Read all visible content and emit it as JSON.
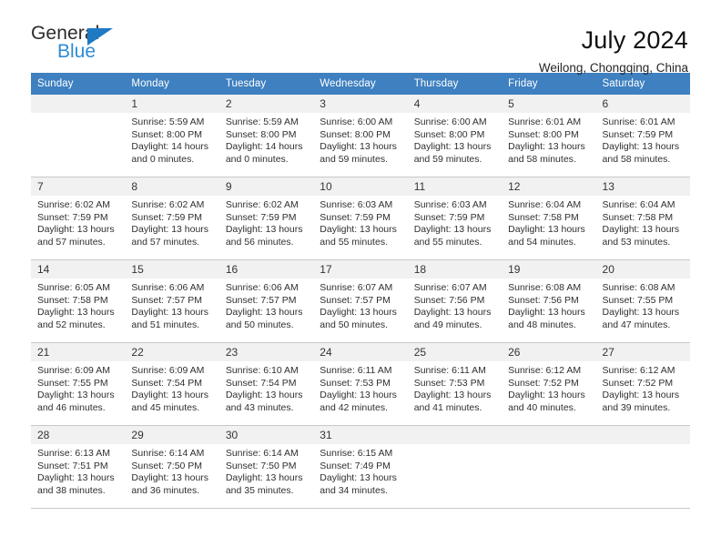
{
  "brand": {
    "name_top": "General",
    "name_bottom": "Blue",
    "accent_color": "#2e8bd4",
    "triangle_color": "#1f7ac4",
    "triangle_icon": "triangle-icon"
  },
  "header": {
    "title": "July 2024",
    "subtitle": "Weilong, Chongqing, China"
  },
  "calendar": {
    "header_bg": "#3e80c0",
    "header_text_color": "#ffffff",
    "daynum_bg": "#f1f1f1",
    "weekday_headers": [
      "Sunday",
      "Monday",
      "Tuesday",
      "Wednesday",
      "Thursday",
      "Friday",
      "Saturday"
    ],
    "weeks": [
      [
        {
          "day": "",
          "empty": true,
          "sunrise": "",
          "sunset": "",
          "daylight_line1": "",
          "daylight_line2": ""
        },
        {
          "day": "1",
          "empty": false,
          "sunrise": "Sunrise: 5:59 AM",
          "sunset": "Sunset: 8:00 PM",
          "daylight_line1": "Daylight: 14 hours",
          "daylight_line2": "and 0 minutes."
        },
        {
          "day": "2",
          "empty": false,
          "sunrise": "Sunrise: 5:59 AM",
          "sunset": "Sunset: 8:00 PM",
          "daylight_line1": "Daylight: 14 hours",
          "daylight_line2": "and 0 minutes."
        },
        {
          "day": "3",
          "empty": false,
          "sunrise": "Sunrise: 6:00 AM",
          "sunset": "Sunset: 8:00 PM",
          "daylight_line1": "Daylight: 13 hours",
          "daylight_line2": "and 59 minutes."
        },
        {
          "day": "4",
          "empty": false,
          "sunrise": "Sunrise: 6:00 AM",
          "sunset": "Sunset: 8:00 PM",
          "daylight_line1": "Daylight: 13 hours",
          "daylight_line2": "and 59 minutes."
        },
        {
          "day": "5",
          "empty": false,
          "sunrise": "Sunrise: 6:01 AM",
          "sunset": "Sunset: 8:00 PM",
          "daylight_line1": "Daylight: 13 hours",
          "daylight_line2": "and 58 minutes."
        },
        {
          "day": "6",
          "empty": false,
          "sunrise": "Sunrise: 6:01 AM",
          "sunset": "Sunset: 7:59 PM",
          "daylight_line1": "Daylight: 13 hours",
          "daylight_line2": "and 58 minutes."
        }
      ],
      [
        {
          "day": "7",
          "empty": false,
          "sunrise": "Sunrise: 6:02 AM",
          "sunset": "Sunset: 7:59 PM",
          "daylight_line1": "Daylight: 13 hours",
          "daylight_line2": "and 57 minutes."
        },
        {
          "day": "8",
          "empty": false,
          "sunrise": "Sunrise: 6:02 AM",
          "sunset": "Sunset: 7:59 PM",
          "daylight_line1": "Daylight: 13 hours",
          "daylight_line2": "and 57 minutes."
        },
        {
          "day": "9",
          "empty": false,
          "sunrise": "Sunrise: 6:02 AM",
          "sunset": "Sunset: 7:59 PM",
          "daylight_line1": "Daylight: 13 hours",
          "daylight_line2": "and 56 minutes."
        },
        {
          "day": "10",
          "empty": false,
          "sunrise": "Sunrise: 6:03 AM",
          "sunset": "Sunset: 7:59 PM",
          "daylight_line1": "Daylight: 13 hours",
          "daylight_line2": "and 55 minutes."
        },
        {
          "day": "11",
          "empty": false,
          "sunrise": "Sunrise: 6:03 AM",
          "sunset": "Sunset: 7:59 PM",
          "daylight_line1": "Daylight: 13 hours",
          "daylight_line2": "and 55 minutes."
        },
        {
          "day": "12",
          "empty": false,
          "sunrise": "Sunrise: 6:04 AM",
          "sunset": "Sunset: 7:58 PM",
          "daylight_line1": "Daylight: 13 hours",
          "daylight_line2": "and 54 minutes."
        },
        {
          "day": "13",
          "empty": false,
          "sunrise": "Sunrise: 6:04 AM",
          "sunset": "Sunset: 7:58 PM",
          "daylight_line1": "Daylight: 13 hours",
          "daylight_line2": "and 53 minutes."
        }
      ],
      [
        {
          "day": "14",
          "empty": false,
          "sunrise": "Sunrise: 6:05 AM",
          "sunset": "Sunset: 7:58 PM",
          "daylight_line1": "Daylight: 13 hours",
          "daylight_line2": "and 52 minutes."
        },
        {
          "day": "15",
          "empty": false,
          "sunrise": "Sunrise: 6:06 AM",
          "sunset": "Sunset: 7:57 PM",
          "daylight_line1": "Daylight: 13 hours",
          "daylight_line2": "and 51 minutes."
        },
        {
          "day": "16",
          "empty": false,
          "sunrise": "Sunrise: 6:06 AM",
          "sunset": "Sunset: 7:57 PM",
          "daylight_line1": "Daylight: 13 hours",
          "daylight_line2": "and 50 minutes."
        },
        {
          "day": "17",
          "empty": false,
          "sunrise": "Sunrise: 6:07 AM",
          "sunset": "Sunset: 7:57 PM",
          "daylight_line1": "Daylight: 13 hours",
          "daylight_line2": "and 50 minutes."
        },
        {
          "day": "18",
          "empty": false,
          "sunrise": "Sunrise: 6:07 AM",
          "sunset": "Sunset: 7:56 PM",
          "daylight_line1": "Daylight: 13 hours",
          "daylight_line2": "and 49 minutes."
        },
        {
          "day": "19",
          "empty": false,
          "sunrise": "Sunrise: 6:08 AM",
          "sunset": "Sunset: 7:56 PM",
          "daylight_line1": "Daylight: 13 hours",
          "daylight_line2": "and 48 minutes."
        },
        {
          "day": "20",
          "empty": false,
          "sunrise": "Sunrise: 6:08 AM",
          "sunset": "Sunset: 7:55 PM",
          "daylight_line1": "Daylight: 13 hours",
          "daylight_line2": "and 47 minutes."
        }
      ],
      [
        {
          "day": "21",
          "empty": false,
          "sunrise": "Sunrise: 6:09 AM",
          "sunset": "Sunset: 7:55 PM",
          "daylight_line1": "Daylight: 13 hours",
          "daylight_line2": "and 46 minutes."
        },
        {
          "day": "22",
          "empty": false,
          "sunrise": "Sunrise: 6:09 AM",
          "sunset": "Sunset: 7:54 PM",
          "daylight_line1": "Daylight: 13 hours",
          "daylight_line2": "and 45 minutes."
        },
        {
          "day": "23",
          "empty": false,
          "sunrise": "Sunrise: 6:10 AM",
          "sunset": "Sunset: 7:54 PM",
          "daylight_line1": "Daylight: 13 hours",
          "daylight_line2": "and 43 minutes."
        },
        {
          "day": "24",
          "empty": false,
          "sunrise": "Sunrise: 6:11 AM",
          "sunset": "Sunset: 7:53 PM",
          "daylight_line1": "Daylight: 13 hours",
          "daylight_line2": "and 42 minutes."
        },
        {
          "day": "25",
          "empty": false,
          "sunrise": "Sunrise: 6:11 AM",
          "sunset": "Sunset: 7:53 PM",
          "daylight_line1": "Daylight: 13 hours",
          "daylight_line2": "and 41 minutes."
        },
        {
          "day": "26",
          "empty": false,
          "sunrise": "Sunrise: 6:12 AM",
          "sunset": "Sunset: 7:52 PM",
          "daylight_line1": "Daylight: 13 hours",
          "daylight_line2": "and 40 minutes."
        },
        {
          "day": "27",
          "empty": false,
          "sunrise": "Sunrise: 6:12 AM",
          "sunset": "Sunset: 7:52 PM",
          "daylight_line1": "Daylight: 13 hours",
          "daylight_line2": "and 39 minutes."
        }
      ],
      [
        {
          "day": "28",
          "empty": false,
          "sunrise": "Sunrise: 6:13 AM",
          "sunset": "Sunset: 7:51 PM",
          "daylight_line1": "Daylight: 13 hours",
          "daylight_line2": "and 38 minutes."
        },
        {
          "day": "29",
          "empty": false,
          "sunrise": "Sunrise: 6:14 AM",
          "sunset": "Sunset: 7:50 PM",
          "daylight_line1": "Daylight: 13 hours",
          "daylight_line2": "and 36 minutes."
        },
        {
          "day": "30",
          "empty": false,
          "sunrise": "Sunrise: 6:14 AM",
          "sunset": "Sunset: 7:50 PM",
          "daylight_line1": "Daylight: 13 hours",
          "daylight_line2": "and 35 minutes."
        },
        {
          "day": "31",
          "empty": false,
          "sunrise": "Sunrise: 6:15 AM",
          "sunset": "Sunset: 7:49 PM",
          "daylight_line1": "Daylight: 13 hours",
          "daylight_line2": "and 34 minutes."
        },
        {
          "day": "",
          "empty": true,
          "sunrise": "",
          "sunset": "",
          "daylight_line1": "",
          "daylight_line2": ""
        },
        {
          "day": "",
          "empty": true,
          "sunrise": "",
          "sunset": "",
          "daylight_line1": "",
          "daylight_line2": ""
        },
        {
          "day": "",
          "empty": true,
          "sunrise": "",
          "sunset": "",
          "daylight_line1": "",
          "daylight_line2": ""
        }
      ]
    ]
  }
}
